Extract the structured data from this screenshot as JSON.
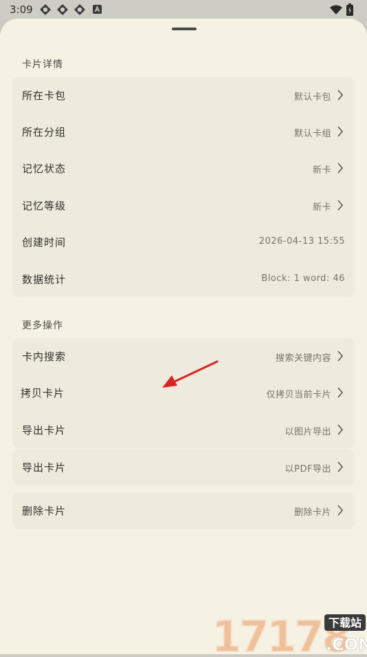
{
  "status_bar": {
    "time": "3:09",
    "icons": [
      "settings-gear-icon",
      "settings-gear-icon",
      "settings-gear-icon",
      "a-badge-icon"
    ],
    "right_icons": [
      "wifi-icon",
      "battery-icon"
    ]
  },
  "sheet": {
    "section_details": {
      "title": "卡片详情",
      "rows": [
        {
          "label": "所在卡包",
          "value": "默认卡包"
        },
        {
          "label": "所在分组",
          "value": "默认卡组"
        },
        {
          "label": "记忆状态",
          "value": "新卡"
        },
        {
          "label": "记忆等级",
          "value": "新卡"
        },
        {
          "label": "创建时间",
          "value": "2026-04-13 15:55"
        },
        {
          "label": "数据统计",
          "value": "Block: 1  word: 46"
        }
      ]
    },
    "section_more": {
      "title": "更多操作",
      "rows": [
        {
          "label": "卡内搜索",
          "value": "搜索关键内容"
        },
        {
          "label": "拷贝卡片",
          "value": "仅拷贝当前卡片"
        },
        {
          "label": "导出卡片",
          "value": "以图片导出"
        }
      ],
      "export_pdf": {
        "label": "导出卡片",
        "value": "以PDF导出"
      },
      "delete": {
        "label": "删除卡片",
        "value": "删除卡片"
      }
    }
  },
  "watermark": {
    "number": "17178",
    "badge": "下载站",
    "domain": ".COM"
  },
  "colors": {
    "sheet_bg": "#f6f2e3",
    "card_bg": "#eeeadd",
    "annotation_arrow": "#d92323"
  }
}
